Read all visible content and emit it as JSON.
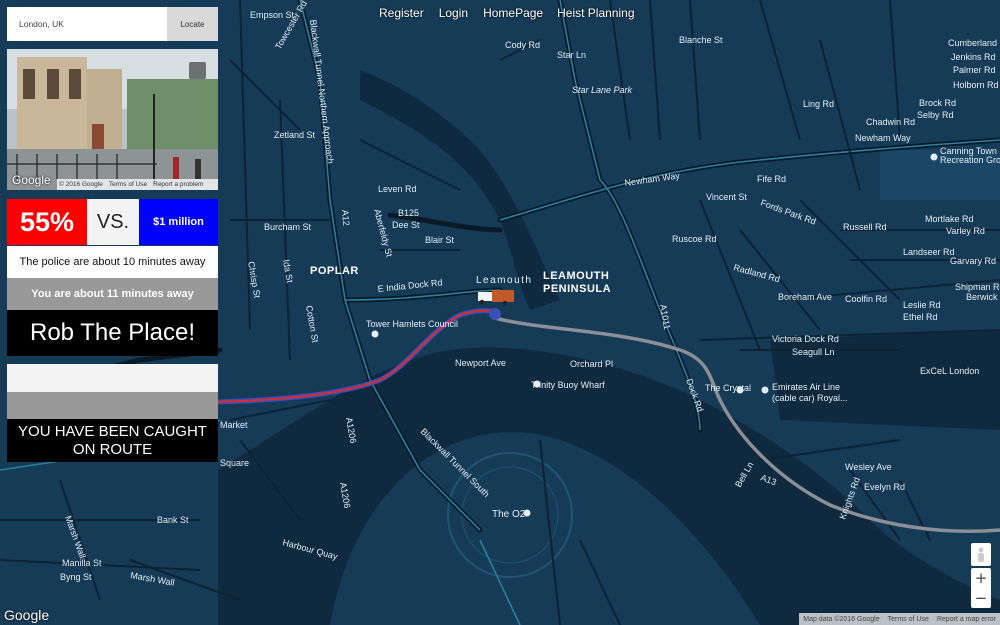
{
  "nav": {
    "register": "Register",
    "login": "Login",
    "homepage": "HomePage",
    "heist_planning": "Heist Planning"
  },
  "search": {
    "value": "London, UK",
    "button": "Locate"
  },
  "street_view": {
    "logo": "Google",
    "copyright": "© 2016 Google",
    "terms": "Terms of Use",
    "report": "Report a problem"
  },
  "odds": {
    "percent": "55%",
    "vs": "VS.",
    "prize": "$1 million",
    "percent_color": "#ff0000",
    "prize_color": "#0000ff"
  },
  "police_text": "The police are about 10 minutes away",
  "you_text": "You are about 11 minutes away",
  "rob_button": "Rob The Place!",
  "caught_text": "YOU HAVE BEEN CAUGHT ON ROUTE",
  "map": {
    "logo": "Google",
    "attribution": {
      "data": "Map data ©2016 Google",
      "terms": "Terms of Use",
      "report": "Report a map error"
    },
    "labels": {
      "poplar": "POPLAR",
      "leamouth_peninsula_1": "LEAMOUTH",
      "leamouth_peninsula_2": "PENINSULA",
      "leamouth": "Leamouth",
      "star_lane_park": "Star Lane Park",
      "the_o2": "The O2",
      "trinity_buoy_wharf": "Trinity Buoy Wharf",
      "tower_hamlets_council": "Tower Hamlets Council",
      "the_crystal": "The Crystal",
      "emirates_1": "Emirates Air Line",
      "emirates_2": "(cable car) Royal...",
      "excel_london": "ExCeL London",
      "canning_town_1": "Canning Town",
      "canning_town_2": "Recreation Gro",
      "e_india_dock_rd": "E India Dock Rd",
      "newham_way_1": "Newham Way",
      "newham_way_2": "Newham Way",
      "victoria_dock_rd": "Victoria Dock Rd",
      "seagull_ln": "Seagull Ln",
      "market": "Market",
      "square": "Square",
      "bank_st": "Bank St",
      "marsh_wall_1": "Marsh Wall",
      "marsh_wall_2": "Marsh Wall",
      "manilla_st": "Manilla St",
      "byng_st": "Byng St",
      "harbour_quay": "Harbour Quay",
      "blackwall_tunnel_south": "Blackwall Tunnel South",
      "blackwall_tunnel_north": "Blackwall Tunnel Northern Approach",
      "towcester_rd": "Towcester Rd",
      "empson_st": "Empson St",
      "zetland_st": "Zetland St",
      "leven_rd": "Leven Rd",
      "aberfeldy_st": "Aberfeldy St",
      "dee_st": "Dee St",
      "blair_st": "Blair St",
      "burcham_st": "Burcham St",
      "ida_st": "Ida St",
      "chrisp_st": "Chrisp St",
      "cotton_st": "Cotton St",
      "newport_ave": "Newport Ave",
      "orchard_pl": "Orchard Pl",
      "dock_rd": "Dock Rd",
      "vincent_st": "Vincent St",
      "fife_rd": "Fife Rd",
      "fords_park_rd": "Fords Park Rd",
      "ruscoe_rd": "Ruscoe Rd",
      "radland_rd": "Radland Rd",
      "boreham_ave": "Boreham Ave",
      "coolfin_rd": "Coolfin Rd",
      "russell_rd": "Russell Rd",
      "mortlake_rd": "Mortlake Rd",
      "varley_rd": "Varley Rd",
      "garvary_rd": "Garvary Rd",
      "shipman_rd": "Shipman Rd",
      "berwick_rd": "Berwick Rd",
      "leslie_rd": "Leslie Rd",
      "ethel_rd": "Ethel Rd",
      "landseer_rd": "Landseer Rd",
      "wesley_ave": "Wesley Ave",
      "evelyn_rd": "Evelyn Rd",
      "knights_rd": "Knights Rd",
      "bell_ln": "Bell Ln",
      "cody_rd": "Cody Rd",
      "star_ln": "Star Ln",
      "blanche_st": "Blanche St",
      "ling_rd": "Ling Rd",
      "chadwin_rd": "Chadwin Rd",
      "cumberland_rd": "Cumberland Rd",
      "jenkins_rd": "Jenkins Rd",
      "palmer_rd": "Palmer Rd",
      "holborn_rd": "Holborn Rd",
      "brock_rd": "Brock Rd",
      "selby_rd": "Selby Rd",
      "a1011": "A1011",
      "a1206": "A1206",
      "a1206_b": "A1206",
      "a12": "A12",
      "a13": "A13",
      "b125": "B125"
    }
  }
}
